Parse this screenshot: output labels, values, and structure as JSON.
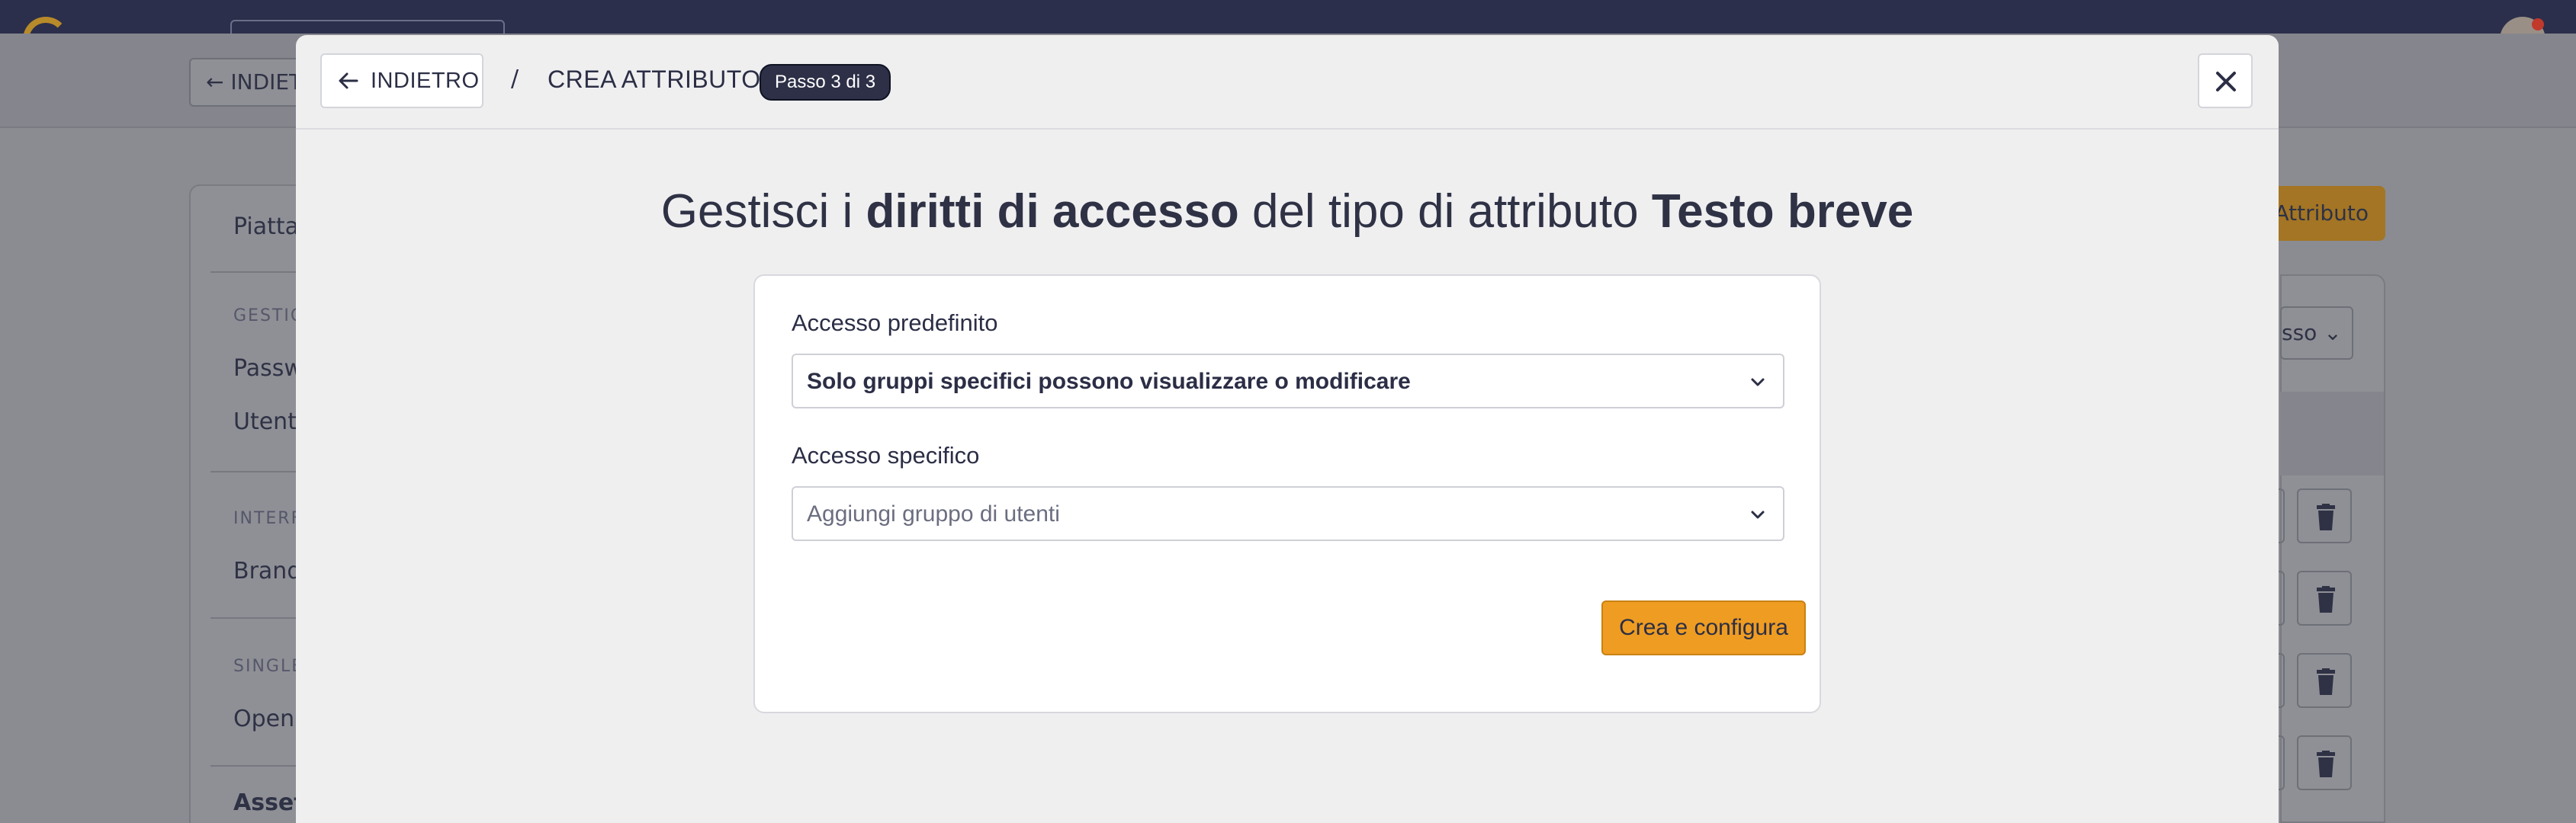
{
  "background": {
    "back_label": "INDIETRO",
    "sidebar": {
      "title": "Piattaforma",
      "sections": [
        {
          "caption": "GESTIONE",
          "items": [
            "Password",
            "Utenti"
          ]
        },
        {
          "caption": "INTERFACCIA",
          "items": [
            "Branding"
          ]
        },
        {
          "caption": "SINGLE SIGN-ON",
          "items": [
            "OpenID"
          ]
        }
      ],
      "footer_title": "Asset"
    },
    "add_attribute_label": "Attributo",
    "access_filter_label": "sso"
  },
  "modal": {
    "back_label": "INDIETRO",
    "separator": "/",
    "breadcrumb": "CREA ATTRIBUTO",
    "step_badge": "Passo 3 di 3",
    "heading": {
      "part1": "Gestisci i ",
      "bold1": "diritti di accesso",
      "part2": " del tipo di attributo ",
      "bold2": "Testo breve"
    },
    "form": {
      "default_access_label": "Accesso predefinito",
      "default_access_value": "Solo gruppi specifici possono visualizzare o modificare",
      "specific_access_label": "Accesso specifico",
      "specific_access_placeholder": "Aggiungi gruppo di utenti",
      "submit_label": "Crea e configura"
    }
  },
  "colors": {
    "accent": "#ee9c22",
    "topbar": "#2b2f4b",
    "badge": "#2d3047"
  }
}
